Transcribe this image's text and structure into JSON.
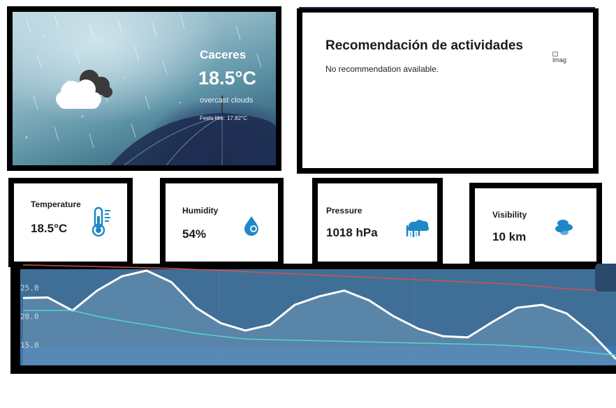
{
  "weather": {
    "city": "Caceres",
    "temperature": "18.5°C",
    "description": "overcast clouds",
    "feels_like_label": "Feels like:",
    "feels_like_value": "17.82°C",
    "icon": "overcast-clouds-icon"
  },
  "recommendation": {
    "title": "Recomendación de actividades",
    "text": "No recommendation available.",
    "image_alt": "Imag"
  },
  "stats": [
    {
      "label": "Temperature",
      "value": "18.5°C",
      "icon": "thermometer-icon"
    },
    {
      "label": "Humidity",
      "value": "54%",
      "icon": "humidity-drop-icon"
    },
    {
      "label": "Pressure",
      "value": "1018 hPa",
      "icon": "pressure-icon"
    },
    {
      "label": "Visibility",
      "value": "10 km",
      "icon": "fog-visibility-icon"
    }
  ],
  "colors": {
    "chart_bg": "#3d6f99",
    "line_main": "#ffffff",
    "line_max": "#d05050",
    "line_min": "#4fd6d0",
    "icon_blue": "#1e88c8"
  },
  "chart_data": {
    "type": "line",
    "yticks": [
      "25.0",
      "20.0",
      "15.0"
    ],
    "ylim": [
      11.5,
      28
    ],
    "x": [
      0,
      1,
      2,
      3,
      4,
      5,
      6,
      7,
      8,
      9,
      10,
      11,
      12,
      13,
      14,
      15,
      16,
      17,
      18,
      19,
      20,
      21,
      22,
      23,
      24
    ],
    "series": [
      {
        "values": [
          23.2,
          23.3,
          21.0,
          24.5,
          27.0,
          28.0,
          26.0,
          21.5,
          18.8,
          17.5,
          18.5,
          22.0,
          23.5,
          24.5,
          22.8,
          20.0,
          17.8,
          16.5,
          16.3,
          19.0,
          21.5,
          22.0,
          20.5,
          17.0,
          12.5
        ]
      },
      {
        "values": [
          29.0,
          28.9,
          28.8,
          28.7,
          28.6,
          28.5,
          28.4,
          28.2,
          28.0,
          27.8,
          27.6,
          27.4,
          27.2,
          27.0,
          26.8,
          26.6,
          26.4,
          26.2,
          26.0,
          25.8,
          25.6,
          25.2,
          24.8,
          24.6,
          24.6
        ]
      },
      {
        "values": [
          21.0,
          21.0,
          21.0,
          20.0,
          19.2,
          18.5,
          17.8,
          17.0,
          16.5,
          16.0,
          15.9,
          15.8,
          15.7,
          15.6,
          15.5,
          15.4,
          15.3,
          15.2,
          15.1,
          15.0,
          14.8,
          14.5,
          14.1,
          13.6,
          13.2
        ]
      }
    ]
  }
}
